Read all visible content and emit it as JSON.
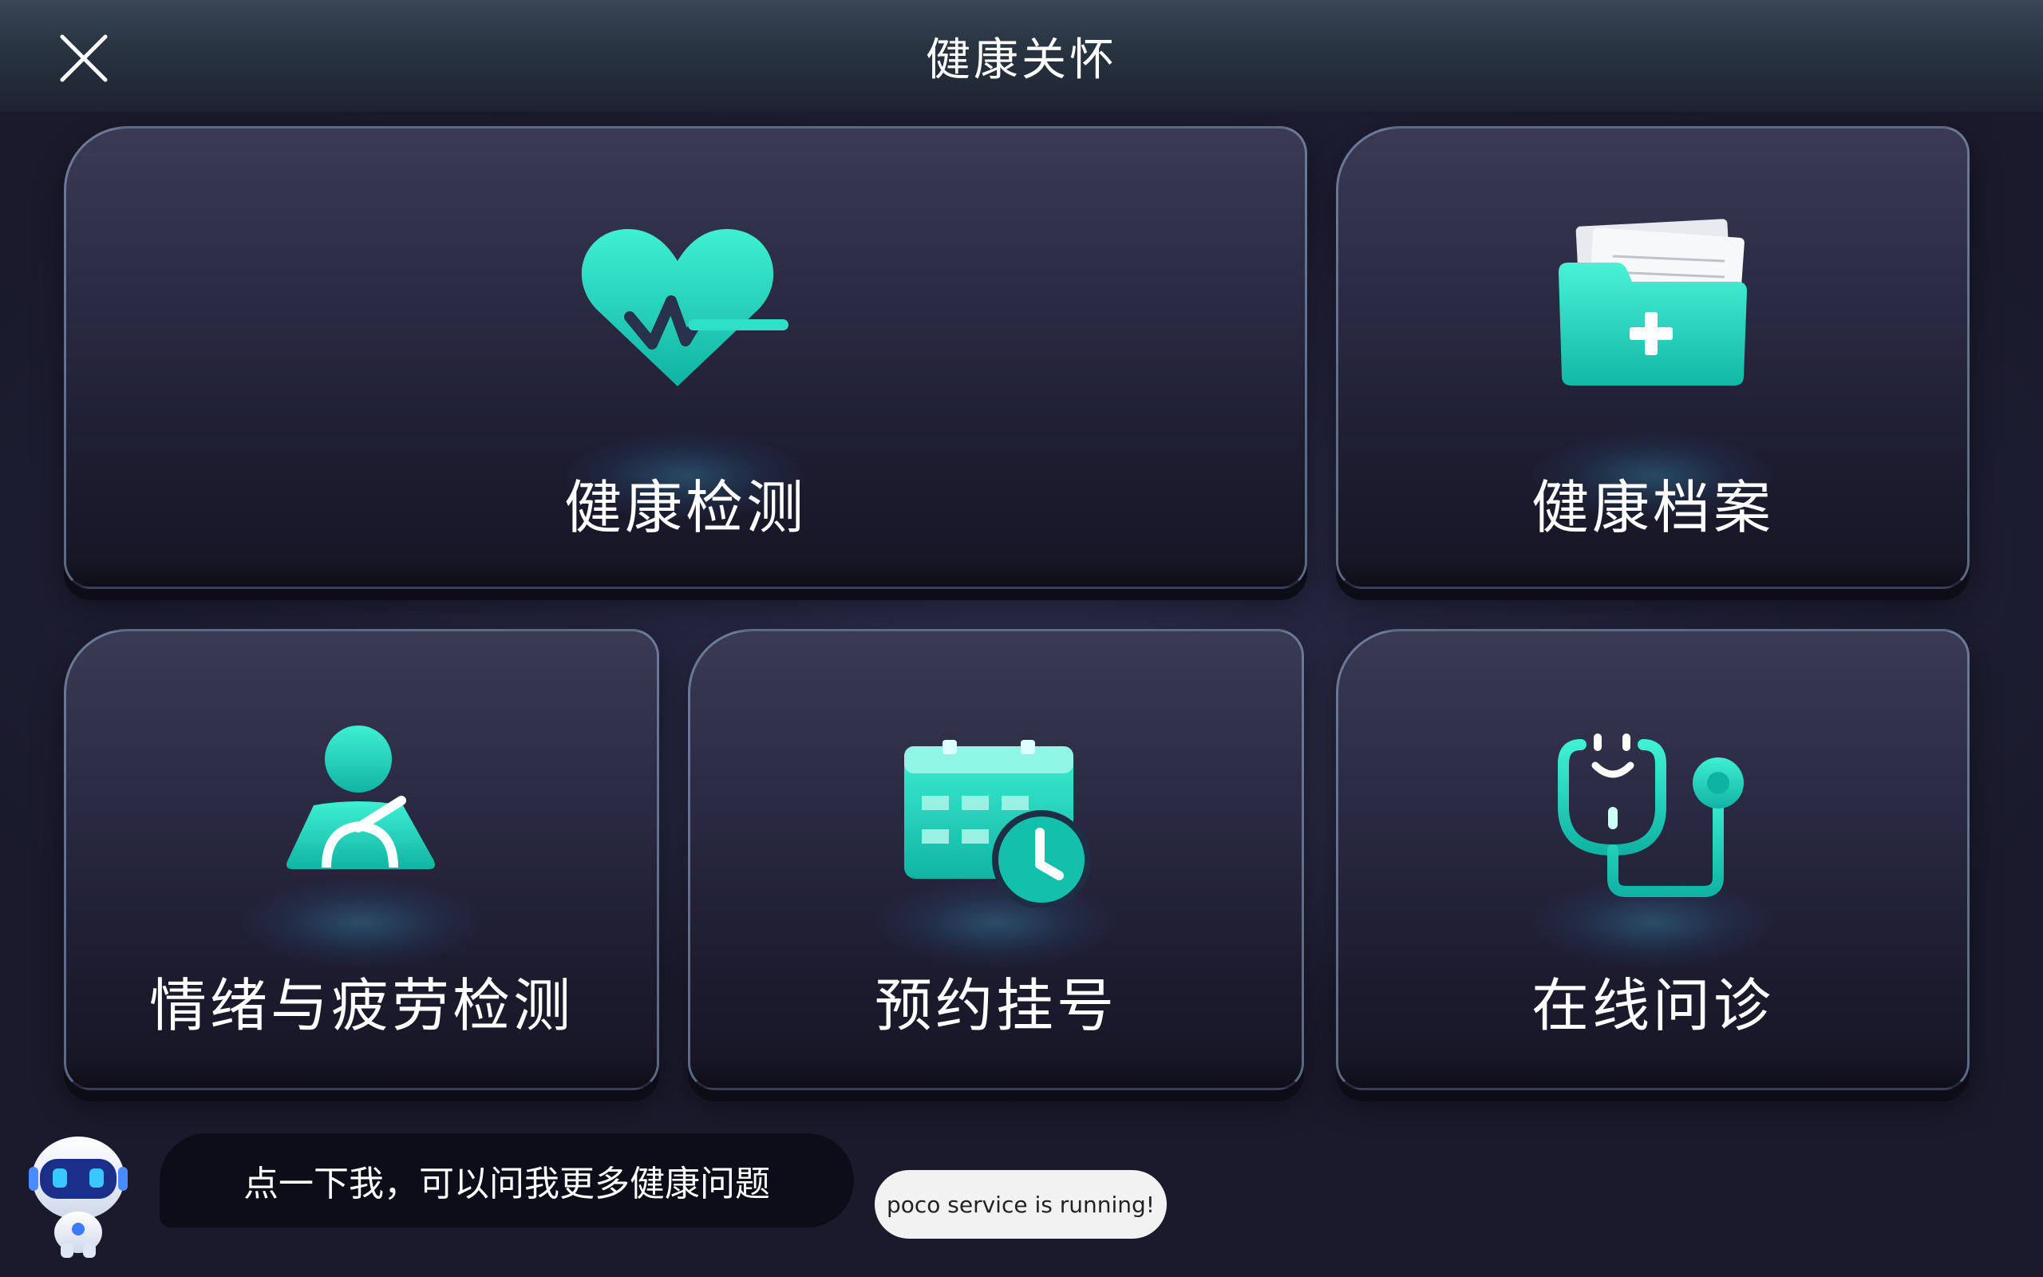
{
  "header": {
    "title": "健康关怀",
    "close_icon": "close-icon"
  },
  "cards": [
    {
      "id": "health-check",
      "label": "健康检测",
      "icon": "heart-pulse-icon"
    },
    {
      "id": "health-records",
      "label": "健康档案",
      "icon": "medical-folder-icon"
    },
    {
      "id": "emotion-fatigue",
      "label": "情绪与疲劳检测",
      "icon": "person-seatbelt-icon"
    },
    {
      "id": "appointment",
      "label": "预约挂号",
      "icon": "calendar-clock-icon"
    },
    {
      "id": "online-consult",
      "label": "在线问诊",
      "icon": "stethoscope-icon"
    }
  ],
  "assistant": {
    "avatar_icon": "robot-icon",
    "prompt": "点一下我，可以问我更多健康问题"
  },
  "toast": {
    "text": "poco service is running!"
  },
  "colors": {
    "accent": "#2ee0c6",
    "accent_dark": "#0fb3a3",
    "background": "#201f36",
    "card_border": "#8fa8c8"
  }
}
